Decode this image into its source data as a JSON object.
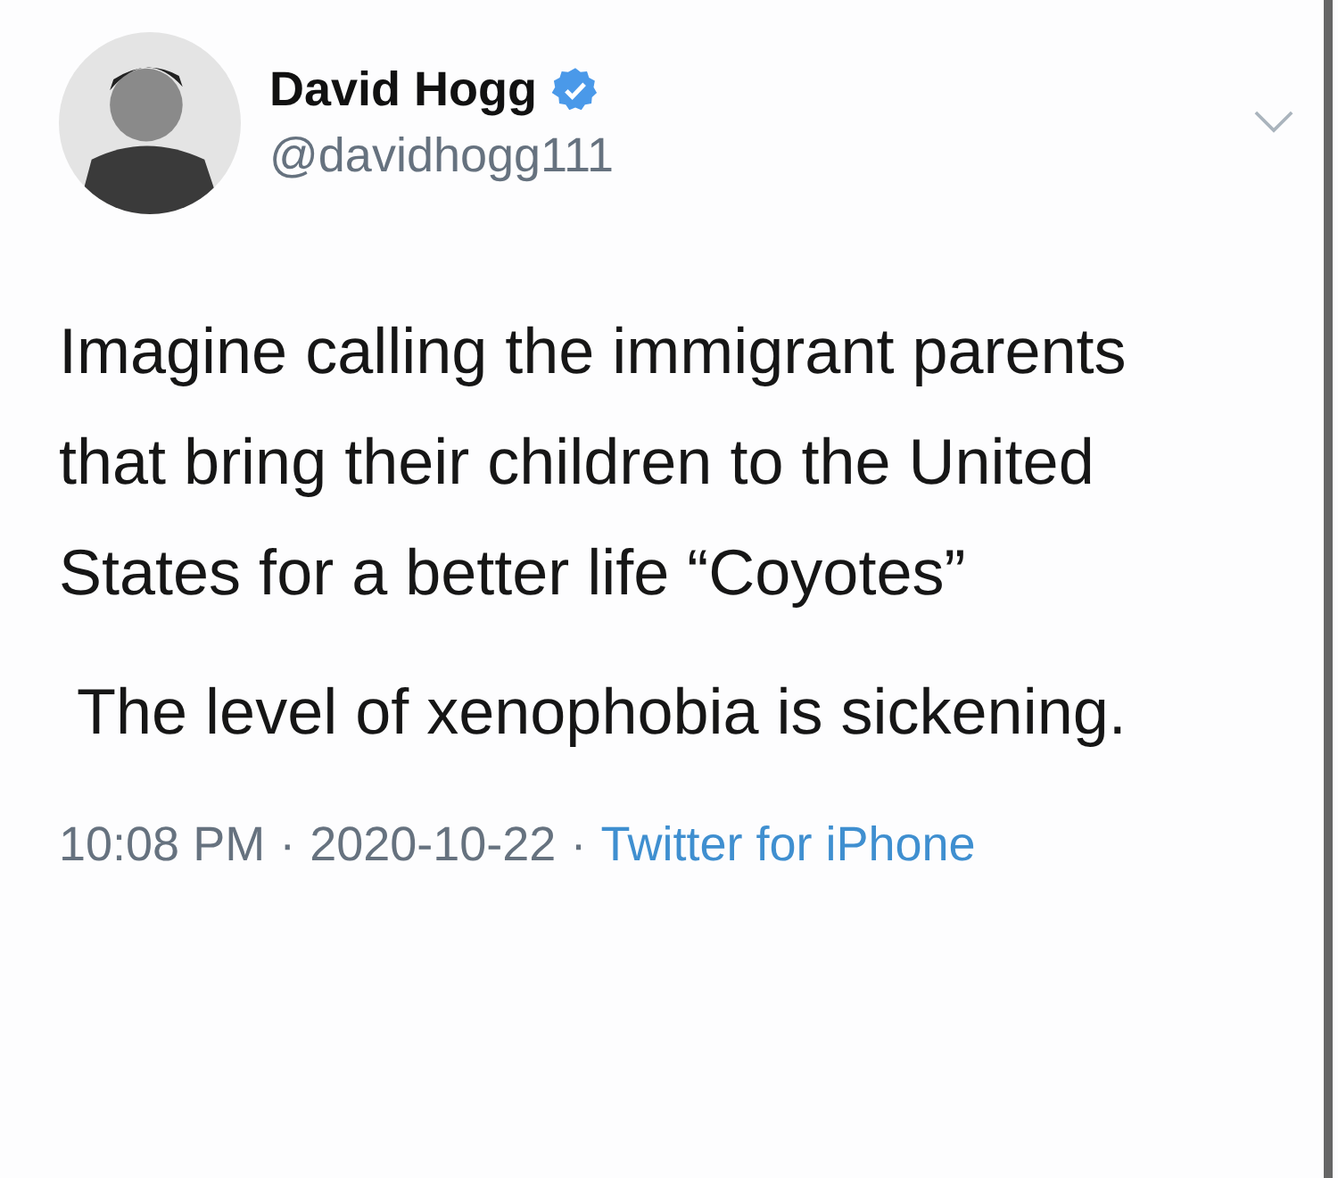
{
  "author": {
    "name": "David Hogg",
    "verified": true,
    "handle": "@davidhogg111"
  },
  "paragraphs": [
    "Imagine calling the immigrant parents that bring their children to the United States for a better life “Coyotes”",
    " The level of xenophobia is sickening."
  ],
  "meta": {
    "time": "10:08 PM",
    "separator_1": "·",
    "date": "2020-10-22",
    "separator_2": "·",
    "source": "Twitter for iPhone"
  }
}
